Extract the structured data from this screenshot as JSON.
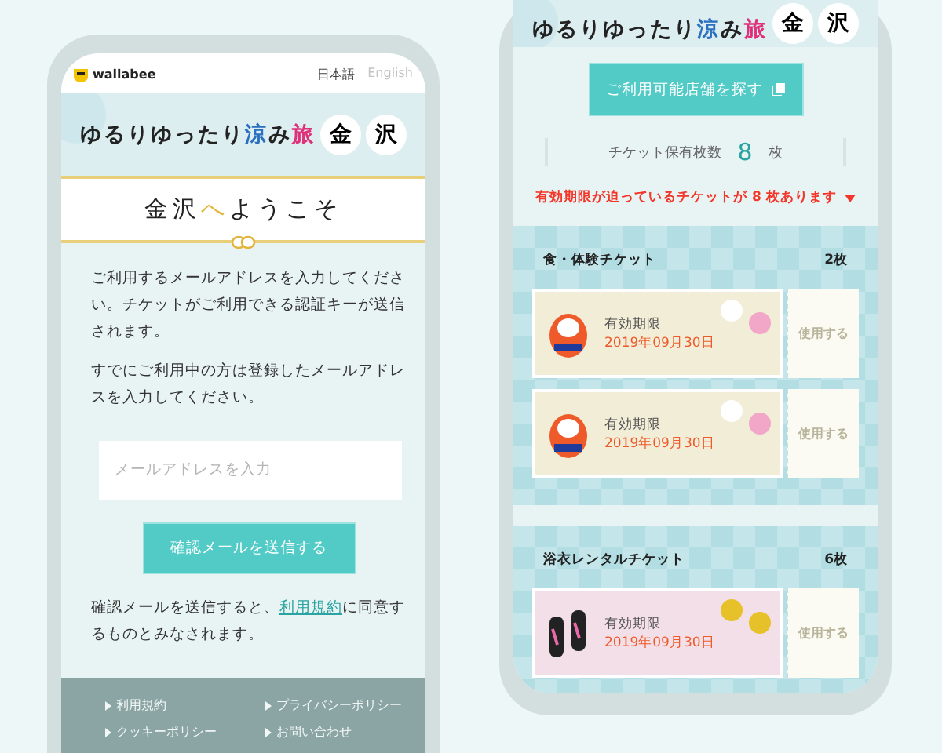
{
  "left": {
    "header": {
      "logo": "wallabee",
      "languages": [
        {
          "label": "日本語",
          "selected": true
        },
        {
          "label": "English",
          "selected": false
        }
      ]
    },
    "banner": {
      "title": [
        {
          "text": "ゆるりゆったり"
        },
        {
          "text": "涼",
          "color": "#2a6fc0"
        },
        {
          "text": "み"
        },
        {
          "text": "旅",
          "color": "#e0307a"
        }
      ],
      "badges": [
        "金",
        "沢"
      ]
    },
    "welcome": [
      {
        "text": "金沢",
        "accent": false
      },
      {
        "text": "へ",
        "accent": true
      },
      {
        "text": "ようこそ",
        "accent": false
      }
    ],
    "paragraphs": [
      "ご利用するメールアドレスを入力してください。チケットがご利用できる認証キーが送信されます。",
      "すでにご利用中の方は登録したメールアドレスを入力してください。"
    ],
    "email": {
      "placeholder": "メールアドレスを入力"
    },
    "submit": "確認メールを送信する",
    "agreement": {
      "before": "確認メールを送信すると、",
      "link": "利用規約",
      "after": "に同意するものとみなされます。"
    },
    "footer_links": [
      "利用規約",
      "プライバシーポリシー",
      "クッキーポリシー",
      "お問い合わせ"
    ]
  },
  "right": {
    "banner": {
      "title": [
        {
          "text": "ゆるりゆったり"
        },
        {
          "text": "涼",
          "color": "#2a6fc0"
        },
        {
          "text": "み"
        },
        {
          "text": "旅",
          "color": "#e0307a"
        }
      ],
      "badges": [
        "金",
        "沢"
      ]
    },
    "store_button": "ご利用可能店舗を探す",
    "count": {
      "label": "チケット保有枚数",
      "value": "8",
      "unit": "枚"
    },
    "warning": "有効期限が迫っているチケットが 8 枚あります",
    "sections": [
      {
        "title": "食・体験チケット",
        "count": "2枚",
        "tickets": [
          {
            "kind": "daruma",
            "label": "有効期限",
            "date": "2019年09月30日",
            "action": "使用する"
          },
          {
            "kind": "daruma",
            "label": "有効期限",
            "date": "2019年09月30日",
            "action": "使用する"
          }
        ]
      },
      {
        "title": "浴衣レンタルチケット",
        "count": "6枚",
        "tickets": [
          {
            "kind": "sandals",
            "label": "有効期限",
            "date": "2019年09月30日",
            "action": "使用する"
          }
        ]
      }
    ]
  }
}
